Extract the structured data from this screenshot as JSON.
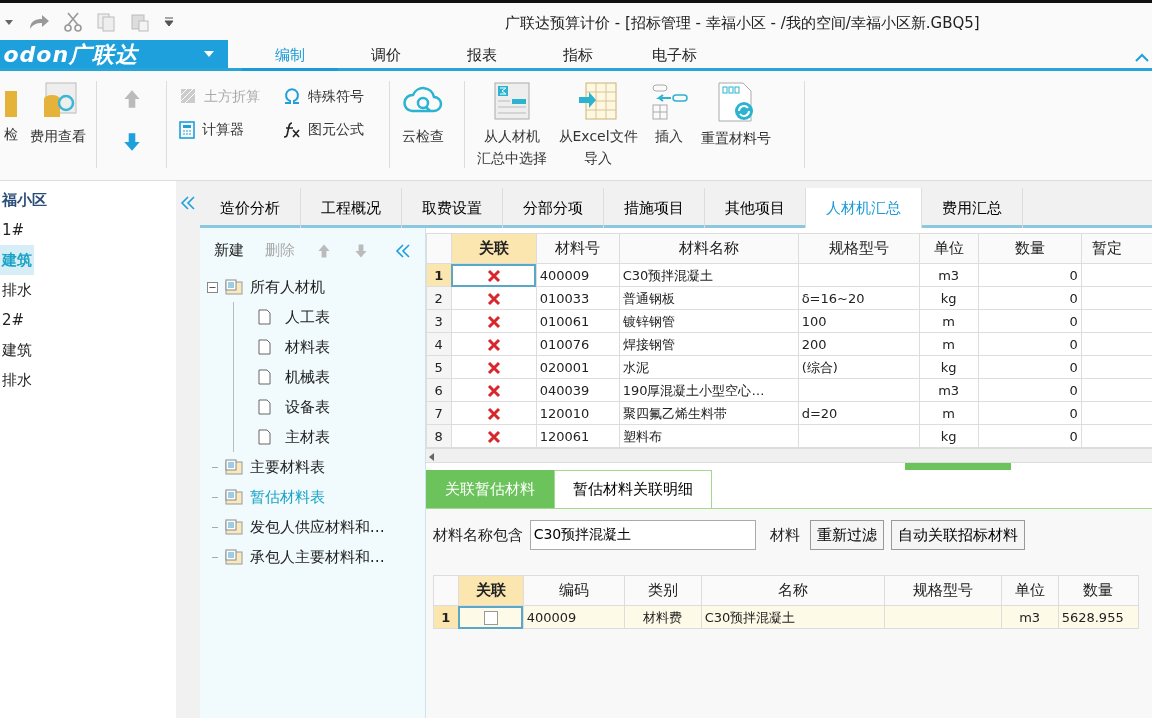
{
  "window": {
    "title": "广联达预算计价 - [招标管理 - 幸福小区 - /我的空间/幸福小区新.GBQ5]"
  },
  "app_menu": {
    "label": "odon广联达"
  },
  "ribbon_tabs": [
    {
      "label": "编制",
      "selected": true
    },
    {
      "label": "调价",
      "selected": false
    },
    {
      "label": "报表",
      "selected": false
    },
    {
      "label": "指标",
      "selected": false
    },
    {
      "label": "电子标",
      "selected": false
    }
  ],
  "ribbon_groups": [
    {
      "items": [
        {
          "kind": "large",
          "label": "检",
          "disabled": false
        },
        {
          "kind": "large",
          "label": "费用查看",
          "disabled": false
        }
      ]
    },
    {
      "items": [
        {
          "kind": "arrow",
          "disabled": true
        },
        {
          "kind": "arrow",
          "disabled": false
        }
      ]
    },
    {
      "items": [
        {
          "kind": "small",
          "label": "土方折算",
          "disabled": true
        },
        {
          "kind": "small",
          "label": "特殊符号",
          "disabled": false
        },
        {
          "kind": "small",
          "label": "计算器",
          "disabled": false
        },
        {
          "kind": "small",
          "label": "图元公式",
          "disabled": false
        }
      ]
    },
    {
      "items": [
        {
          "kind": "large",
          "label": "云检查",
          "disabled": false
        }
      ]
    },
    {
      "items": [
        {
          "kind": "large",
          "lines": [
            "从人材机",
            "汇总中选择"
          ],
          "disabled": false
        },
        {
          "kind": "large",
          "lines": [
            "从Excel文件",
            "导入"
          ],
          "disabled": false
        },
        {
          "kind": "large",
          "label": "插入",
          "disabled": false
        },
        {
          "kind": "large",
          "label": "重置材料号",
          "disabled": false
        }
      ]
    }
  ],
  "project_tree": [
    {
      "label": "福小区",
      "selected": false,
      "children": [
        {
          "label": "1#",
          "selected": false,
          "children": [
            {
              "label": "建筑",
              "selected": true
            },
            {
              "label": "排水",
              "selected": false
            }
          ]
        },
        {
          "label": "2#",
          "selected": false,
          "children": [
            {
              "label": "建筑",
              "selected": false
            },
            {
              "label": "排水",
              "selected": false
            }
          ]
        }
      ]
    }
  ],
  "view_tabs": [
    {
      "label": "造价分析",
      "selected": false
    },
    {
      "label": "工程概况",
      "selected": false
    },
    {
      "label": "取费设置",
      "selected": false
    },
    {
      "label": "分部分项",
      "selected": false
    },
    {
      "label": "措施项目",
      "selected": false
    },
    {
      "label": "其他项目",
      "selected": false
    },
    {
      "label": "人材机汇总",
      "selected": true
    },
    {
      "label": "费用汇总",
      "selected": false
    }
  ],
  "side_toolbar": [
    {
      "kind": "text",
      "label": "新建",
      "disabled": false
    },
    {
      "kind": "text",
      "label": "删除",
      "disabled": true
    },
    {
      "kind": "up",
      "disabled": true
    },
    {
      "kind": "down",
      "disabled": true
    }
  ],
  "material_tree": [
    {
      "label": "所有人材机",
      "selected": false,
      "expanded": true,
      "children": [
        {
          "label": "人工表",
          "selected": false
        },
        {
          "label": "材料表",
          "selected": false
        },
        {
          "label": "机械表",
          "selected": false
        },
        {
          "label": "设备表",
          "selected": false
        },
        {
          "label": "主材表",
          "selected": false
        }
      ]
    },
    {
      "label": "主要材料表",
      "selected": false
    },
    {
      "label": "暂估材料表",
      "selected": true
    },
    {
      "label": "发包人供应材料和…",
      "selected": false
    },
    {
      "label": "承包人主要材料和…",
      "selected": false
    }
  ],
  "materials_table": {
    "columns": [
      "关联",
      "材料号",
      "材料名称",
      "规格型号",
      "单位",
      "数量",
      "暂定"
    ],
    "rows": [
      {
        "number": "1",
        "selected": true,
        "linked": false,
        "code": "400009",
        "name": "C30预拌混凝土",
        "unit": "m3",
        "quantity": "0"
      },
      {
        "number": "2",
        "selected": false,
        "linked": false,
        "code": "010033",
        "name": "普通钢板",
        "spec": "δ=16~20",
        "unit": "kg",
        "quantity": "0"
      },
      {
        "number": "3",
        "selected": false,
        "linked": false,
        "code": "010061",
        "name": "镀锌钢管",
        "spec": "100",
        "unit": "m",
        "quantity": "0"
      },
      {
        "number": "4",
        "selected": false,
        "linked": false,
        "code": "010076",
        "name": "焊接钢管",
        "spec": "200",
        "unit": "m",
        "quantity": "0"
      },
      {
        "number": "5",
        "selected": false,
        "linked": false,
        "code": "020001",
        "name": "水泥",
        "spec": "(综合)",
        "unit": "kg",
        "quantity": "0"
      },
      {
        "number": "6",
        "selected": false,
        "linked": false,
        "code": "040039",
        "name": "190厚混凝土小型空心…",
        "unit": "m3",
        "quantity": "0"
      },
      {
        "number": "7",
        "selected": false,
        "linked": false,
        "code": "120010",
        "name": "聚四氟乙烯生料带",
        "spec": "d=20",
        "unit": "m",
        "quantity": "0"
      },
      {
        "number": "8",
        "selected": false,
        "linked": false,
        "code": "120061",
        "name": "塑料布",
        "unit": "kg",
        "quantity": "0"
      }
    ]
  },
  "detail_tabs": [
    {
      "label": "关联暂估材料",
      "selected": true
    },
    {
      "label": "暂估材料关联明细",
      "selected": false
    }
  ],
  "filter": {
    "label": "材料名称包含",
    "value": "C30预拌混凝土",
    "suffix": "材料",
    "buttons": [
      "重新过滤",
      "自动关联招标材料"
    ]
  },
  "candidates_table": {
    "columns": [
      "关联",
      "编码",
      "类别",
      "名称",
      "规格型号",
      "单位",
      "数量"
    ],
    "rows": [
      {
        "number": "1",
        "selected": true,
        "checked": false,
        "code": "400009",
        "category": "材料费",
        "name": "C30预拌混凝土",
        "unit": "m3",
        "quantity": "5628.955"
      }
    ]
  }
}
